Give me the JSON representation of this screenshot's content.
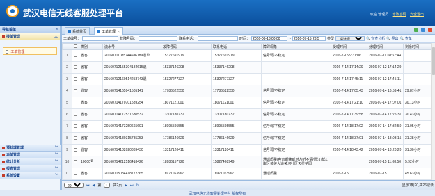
{
  "header": {
    "title": "武汉电信无线客服处理平台",
    "welcome": "欢迎 管理员",
    "change_pwd": "修改密码",
    "logout": "安全退出"
  },
  "sidebar": {
    "title": "导航菜单",
    "collapse": "«",
    "top_menu": "接单管理",
    "item": "工单管理",
    "bottom_menus": [
      "预处理管理",
      "派单管理",
      "统计分析",
      "报表管理",
      "系统设置"
    ]
  },
  "tabs": [
    {
      "label": "系统首页"
    },
    {
      "label": "工单管理",
      "close": "×"
    }
  ],
  "filters": {
    "ticket_no_label": "工单编号：",
    "fault_no_label": "故障号码：",
    "contact_label": "联系电话：",
    "time_label": "时间：",
    "time_from": "2016-06-13 00:00",
    "time_sep": "~",
    "time_to": "2016-07-15 23:5",
    "type_label": "类型",
    "type_value": "请选择",
    "analyze_btn": "宣查分析",
    "export_btn": "导出",
    "query_btn": "查单"
  },
  "table": {
    "headers": [
      "",
      "",
      "类别",
      "流水号",
      "故障号码",
      "联系电话",
      "障碍现象",
      "受理时间",
      "处理时间",
      "剩余时间"
    ],
    "rows": [
      {
        "n": "1",
        "type": "省客",
        "serial": "20160711085744686189退单",
        "fault": "15377691919",
        "contact": "15377691919",
        "issue": "信号弱/不稳定",
        "accept": "2016-7-15 9:31:06",
        "handle": "2016-07-11 08:57:44",
        "remain": ""
      },
      {
        "n": "2",
        "type": "省客",
        "serial": "20160712155304184615退",
        "fault": "15337146208",
        "contact": "15337146208",
        "issue": "",
        "accept": "2016-7-14 17:14:29",
        "handle": "2016-07-12 17:14:29",
        "remain": ""
      },
      {
        "n": "3",
        "type": "省客",
        "serial": "20160712160514258743退",
        "fault": "15327277327",
        "contact": "15327277327",
        "issue": "",
        "accept": "2016-7-14 17:45:11",
        "handle": "2016-07-12 17:45:11",
        "remain": ""
      },
      {
        "n": "4",
        "type": "省客",
        "serial": "20160714165941505141",
        "fault": "17786522550",
        "contact": "17786522550",
        "issue": "信号弱/不稳定",
        "accept": "2016-7-14 17:05:43",
        "handle": "2016-07-14 16:59:41",
        "remain": "29.87小时"
      },
      {
        "n": "5",
        "type": "省客",
        "serial": "20160714170701539254",
        "fault": "18071121001",
        "contact": "18071121001",
        "issue": "信号弱/不稳定",
        "accept": "2016-7-14 17:21:10",
        "handle": "2016-07-14 17:07:01",
        "remain": "30.13小时"
      },
      {
        "n": "6",
        "type": "省客",
        "serial": "20160714172531630532",
        "fault": "13307180732",
        "contact": "13307180732",
        "issue": "信号弱/不稳定",
        "accept": "2016-7-14 17:39:58",
        "handle": "2016-07-14 17:25:31",
        "remain": "30.43小时"
      },
      {
        "n": "7",
        "type": "省客",
        "serial": "20160714173250665691",
        "fault": "18995595555",
        "contact": "18995595555",
        "issue": "信号弱/不稳定",
        "accept": "2016-7-14 18:17:02",
        "handle": "2016-07-14 17:32:50",
        "remain": "31.05小时"
      },
      {
        "n": "8",
        "type": "省客",
        "serial": "20160714180315785253",
        "fault": "17786146629",
        "contact": "17786146629",
        "issue": "信号弱/不稳定",
        "accept": "2016-7-14 18:37:01",
        "handle": "2016-07-14 18:03:15",
        "remain": "31.38小时"
      },
      {
        "n": "9",
        "type": "省客",
        "serial": "20160714182020839430",
        "fault": "13317120411",
        "contact": "13317120411",
        "issue": "信号弱/不稳定",
        "accept": "2016-7-14 18:43:42",
        "handle": "2016-07-14 18:20:20",
        "remain": "31.30小时"
      },
      {
        "n": "10",
        "type": "10000号",
        "serial": "20160714212516418426",
        "fault": "18986157720",
        "contact": "15827468949",
        "issue": "通话质量/声音断续或对方听不清/武汉市江岸区黄陂大道关河社区天星花园",
        "accept": "",
        "handle": "2016-07-15 11:08:50",
        "remain": "5.92小时"
      },
      {
        "n": "11",
        "type": "省客",
        "serial": "20160715084418772365",
        "fault": "18971163967",
        "contact": "18971163967",
        "issue": "通话质量",
        "accept": "2016-7-15",
        "handle": "2016-07-15",
        "remain": "45.63小时"
      }
    ]
  },
  "pager": {
    "page_size": "20",
    "page_prefix": "第",
    "page_value": "1",
    "page_suffix": "共2页",
    "info": "显示1到20,共26记录"
  },
  "footer": "武汉电信无线客服处理平台 版权所有"
}
